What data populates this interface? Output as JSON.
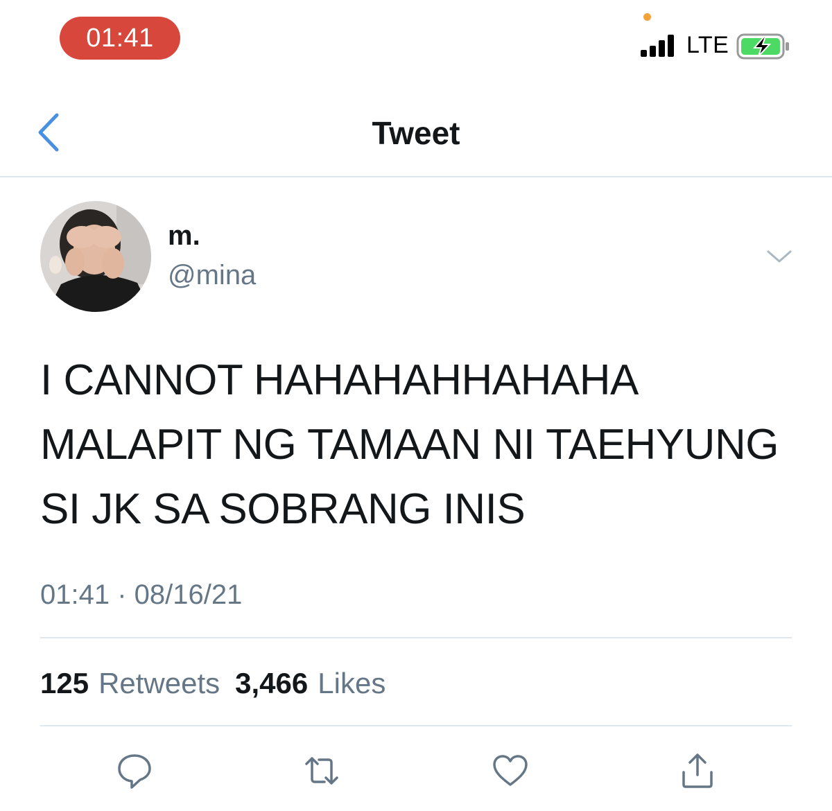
{
  "status_bar": {
    "time": "01:41",
    "network": "LTE",
    "time_pill_color": "#d8473c",
    "battery_color": "#4cd964"
  },
  "nav": {
    "title": "Tweet",
    "back_icon": "chevron-left-icon",
    "accent_color": "#4a90e2"
  },
  "tweet": {
    "author": {
      "display_name": "m.",
      "username": "@mina"
    },
    "text_lines": [
      "I CANNOT HAHAHAHHAHAHA",
      "MALAPIT NG TAMAAN NI TAEHYUNG",
      "SI JK SA SOBRANG INIS"
    ],
    "timestamp": "01:41 · 08/16/21",
    "stats": {
      "retweets_count": "125",
      "retweets_label": "Retweets",
      "likes_count": "3,466",
      "likes_label": "Likes"
    }
  },
  "actions": [
    {
      "name": "reply",
      "icon": "reply-icon"
    },
    {
      "name": "retweet",
      "icon": "retweet-icon"
    },
    {
      "name": "like",
      "icon": "heart-icon"
    },
    {
      "name": "share",
      "icon": "share-icon"
    }
  ]
}
